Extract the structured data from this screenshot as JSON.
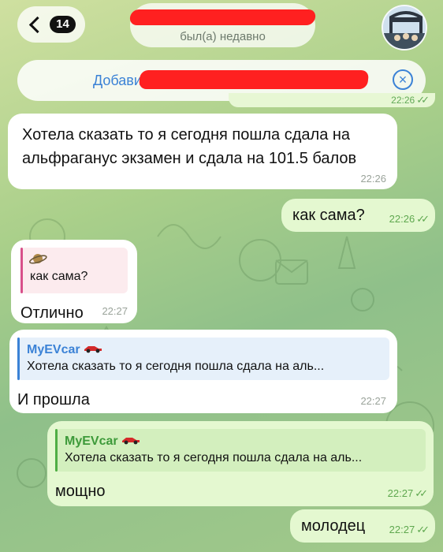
{
  "header": {
    "back_count": "14",
    "contact_name": "redacted",
    "contact_status": "был(а) недавно"
  },
  "banner": {
    "text": "Добавить в контакты",
    "close_icon": "close-circle-icon"
  },
  "peek": {
    "time": "22:26"
  },
  "messages": [
    {
      "side": "in",
      "text_line1": "Хотела сказать то я сегодня пошла сдала на",
      "text_line2": "альфраганус экзамен и сдала на 101.5 балов",
      "time": "22:26"
    },
    {
      "side": "out",
      "text": "как сама?",
      "time": "22:26",
      "read": true
    },
    {
      "side": "in",
      "reply_text": "как сама?",
      "reply_icon": "planet-icon",
      "text": "Отлично",
      "time": "22:27"
    },
    {
      "side": "in",
      "reply_name": "MyEVcar",
      "reply_text": "Хотела сказать то я сегодня пошла сдала на аль...",
      "text": "И прошла",
      "time": "22:27"
    },
    {
      "side": "out",
      "reply_name": "MyEVcar",
      "reply_text": "Хотела сказать то я сегодня пошла сдала на аль...",
      "text": "мощно",
      "time": "22:27",
      "read": true
    },
    {
      "side": "out",
      "text": "молодец",
      "time": "22:27",
      "read": true
    }
  ],
  "colors": {
    "accent": "#3b82d6",
    "outgoing": "#e4f8d0",
    "incoming": "#ffffff",
    "redaction": "#ff2020",
    "check": "#5fa84f"
  }
}
